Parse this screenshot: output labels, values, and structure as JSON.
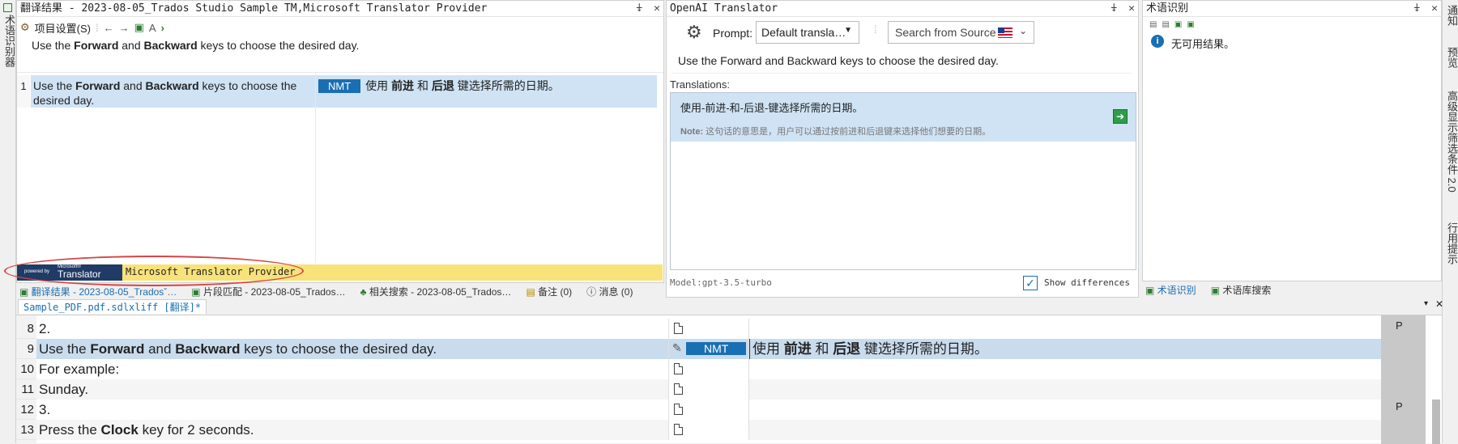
{
  "left_panel": {
    "title": "翻译结果 - 2023-08-05_Trados Studio Sample TM,Microsoft Translator Provider",
    "toolbar_label": "项目设置(S)",
    "source_sentence": {
      "p1": "Use the ",
      "b1": "Forward",
      "p2": " and ",
      "b2": "Backward",
      "p3": " keys to choose the desired day."
    },
    "row_number": "1",
    "row_source": {
      "p1": "Use the ",
      "b1": "Forward",
      "p2": " and ",
      "b2": "Backward",
      "p3": " keys to choose the desired day."
    },
    "nmt_badge": "NMT",
    "row_target": {
      "p1": "使用 ",
      "b1": "前进",
      "p2": " 和 ",
      "b2": "后退",
      "p3": " 键选择所需的日期。"
    },
    "provider_logo_small": "powered by",
    "provider_logo_brand": "Microsoft®",
    "provider_logo_main": "Translator",
    "provider_name": "Microsoft Translator Provider",
    "vertical_tab": "术语识别器",
    "tabs": [
      "翻译结果 - 2023-08-05_Tradosˇ…",
      "片段匹配 - 2023-08-05_Trados…",
      "相关搜索 - 2023-08-05_Trados…",
      "备注 (0)",
      "消息 (0)"
    ]
  },
  "openai_panel": {
    "title": "OpenAI Translator",
    "prompt_label": "Prompt:",
    "prompt_value": "Default transla…",
    "search_label": "Search from Source",
    "source_text": "Use the Forward and Backward keys to choose the desired day.",
    "translations_label": "Translations:",
    "translation": "使用-前进-和-后退-键选择所需的日期。",
    "note_label": "Note:",
    "note_text": " 这句话的意思是，用户可以通过按前进和后退键来选择他们想要的日期。",
    "model": "Model:gpt-3.5-turbo",
    "show_differences": "Show differences",
    "show_differences_checked": true
  },
  "term_panel": {
    "title": "术语识别",
    "no_results": "无可用结果。",
    "tabs": [
      "术语识别",
      "术语库搜索"
    ]
  },
  "right_side_tabs": [
    "通知",
    "预览",
    "高级显示筛选条件 2.0",
    "行用提示"
  ],
  "editor": {
    "file_tab": "Sample_PDF.pdf.sdlxliff [翻译]*",
    "rows": [
      {
        "num": "8",
        "source": {
          "p1": "2."
        },
        "target": {},
        "status": "P"
      },
      {
        "num": "9",
        "source": {
          "p1": "Use the ",
          "b1": "Forward",
          "p2": " and ",
          "b2": "Backward",
          "p3": " keys to choose the desired day."
        },
        "target": {
          "p1": "使用 ",
          "b1": "前进",
          "p2": " 和 ",
          "b2": "后退",
          "p3": " 键选择所需的日期。"
        },
        "badge": "NMT",
        "status": ""
      },
      {
        "num": "10",
        "source": {
          "p1": "For example:"
        },
        "target": {},
        "status": ""
      },
      {
        "num": "11",
        "source": {
          "p1": "Sunday."
        },
        "target": {},
        "status": ""
      },
      {
        "num": "12",
        "source": {
          "p1": "3."
        },
        "target": {},
        "status": "P"
      },
      {
        "num": "13",
        "source": {
          "p1": "Press the ",
          "b1": "Clock",
          "p2": " key for 2 seconds."
        },
        "target": {},
        "status": ""
      }
    ]
  }
}
